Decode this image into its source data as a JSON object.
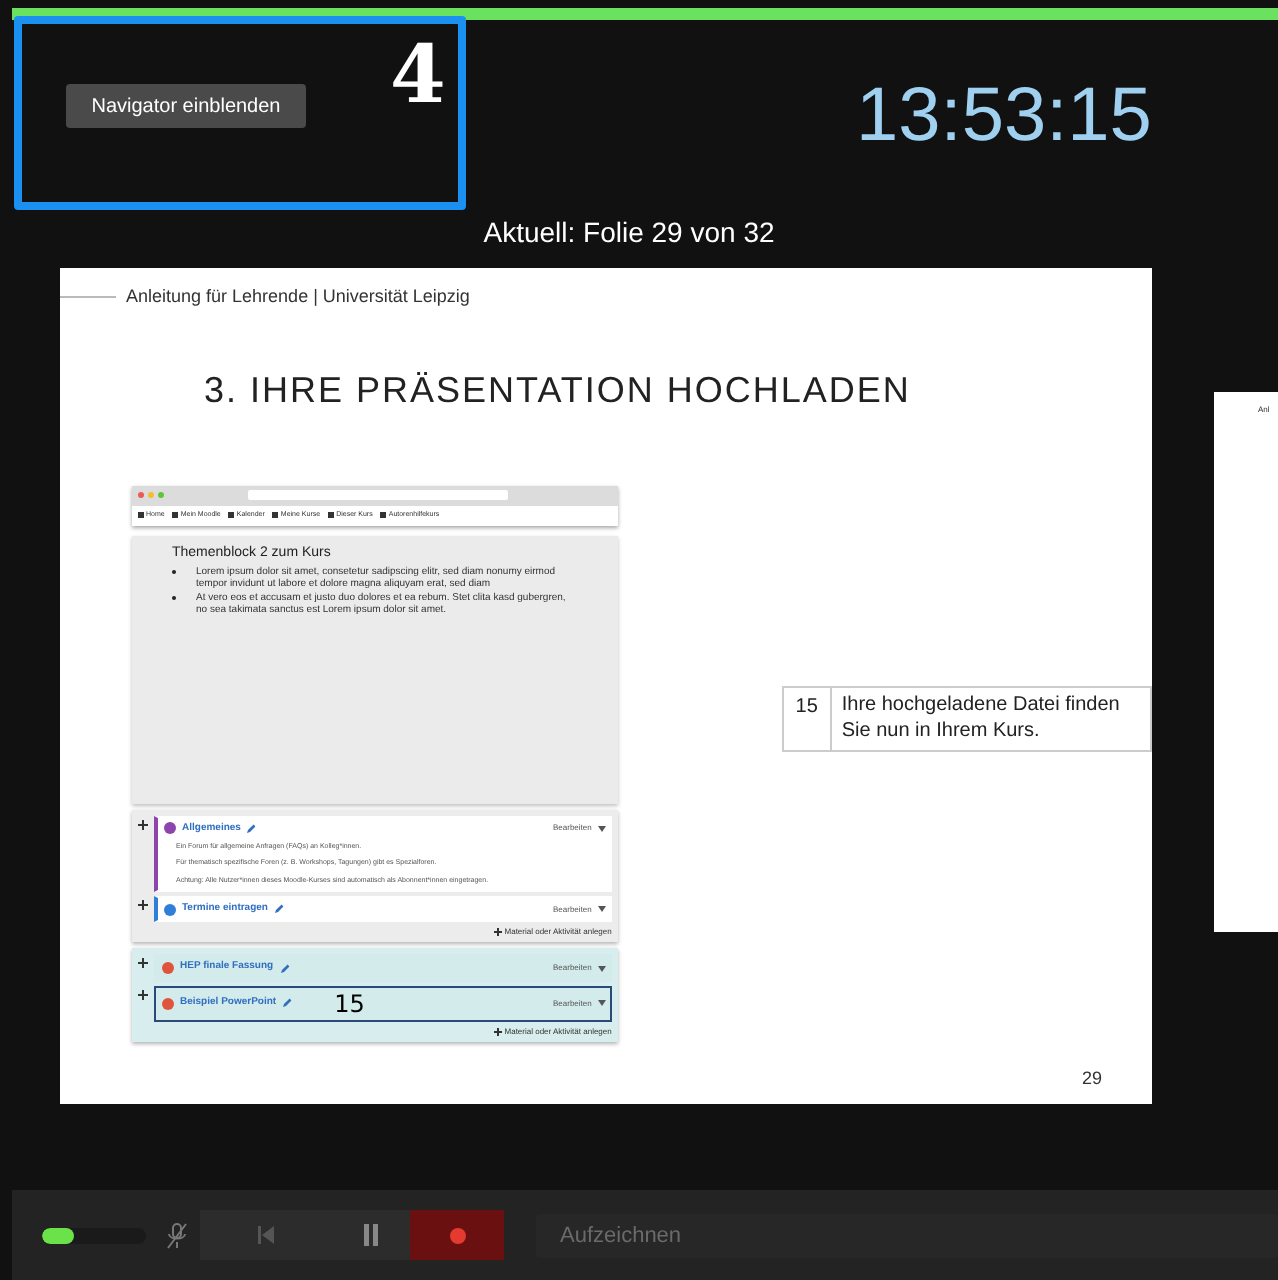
{
  "navigator": {
    "button": "Navigator einblenden",
    "number": "4"
  },
  "clock": "13:53:15",
  "current_label": "Aktuell: Folie 29 von 32",
  "slide": {
    "header": "Anleitung für Lehrende | Universität Leipzig",
    "title": "3. IHRE PRÄSENTATION HOCHLADEN",
    "number": "29",
    "screenshot": {
      "nav_items": [
        "Home",
        "Mein Moodle",
        "Kalender",
        "Meine Kurse",
        "Dieser Kurs",
        "Autorenhilfekurs"
      ],
      "block_title": "Themenblock 2 zum Kurs",
      "bullets": [
        "Lorem ipsum dolor sit amet, consetetur sadipscing elitr, sed diam nonumy eirmod tempor invidunt ut labore et dolore magna aliquyam erat, sed diam",
        "At vero eos et accusam et justo duo dolores et ea rebum. Stet clita kasd gubergren, no sea takimata sanctus est Lorem ipsum dolor sit amet."
      ],
      "sections": [
        {
          "activities": [
            {
              "name": "Allgemeines",
              "color": "#8e44ad",
              "action": "Bearbeiten",
              "highlighted": false,
              "lines": [
                "Ein Forum für allgemeine Anfragen (FAQs) an Kolleg*innen.",
                "Für thematisch spezifische Foren (z. B. Workshops, Tagungen) gibt es Spezialforen.",
                "Achtung: Alle Nutzer*innen dieses Moodle-Kurses sind automatisch als Abonnent*innen eingetragen."
              ]
            },
            {
              "name": "Termine eintragen",
              "color": "#2f7fd8",
              "action": "Bearbeiten",
              "highlighted": false
            }
          ],
          "add": "Material oder Aktivität anlegen"
        },
        {
          "activities": [
            {
              "name": "HEP finale Fassung",
              "color": "#e0533d",
              "action": "Bearbeiten",
              "highlighted": false
            },
            {
              "name": "Beispiel PowerPoint",
              "color": "#e0533d",
              "action": "Bearbeiten",
              "highlighted": true,
              "callout": "15"
            }
          ],
          "add": "Material oder Aktivität anlegen"
        }
      ]
    },
    "note": {
      "number": "15",
      "text": "Ihre hochgeladene Datei finden Sie nun in Ihrem Kurs."
    }
  },
  "next_slide": {
    "header": "Anl"
  },
  "controls": {
    "mic": {
      "level": 0.3
    },
    "record_placeholder": "Aufzeichnen"
  }
}
